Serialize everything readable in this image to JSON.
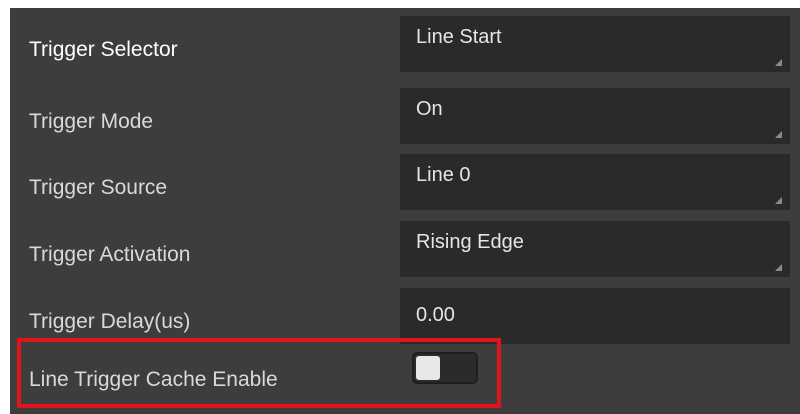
{
  "properties": [
    {
      "label": "Trigger Selector",
      "value": "Line Start",
      "type": "dropdown"
    },
    {
      "label": "Trigger Mode",
      "value": "On",
      "type": "dropdown"
    },
    {
      "label": "Trigger Source",
      "value": "Line 0",
      "type": "dropdown"
    },
    {
      "label": "Trigger Activation",
      "value": "Rising Edge",
      "type": "dropdown"
    },
    {
      "label": "Trigger Delay(us)",
      "value": "0.00",
      "type": "text"
    }
  ],
  "cache_enable": {
    "label": "Line Trigger Cache Enable",
    "state": "off"
  },
  "colors": {
    "panel_bg": "#3d3d3d",
    "field_bg": "#2a2a2a",
    "highlight": "#e2131a"
  }
}
